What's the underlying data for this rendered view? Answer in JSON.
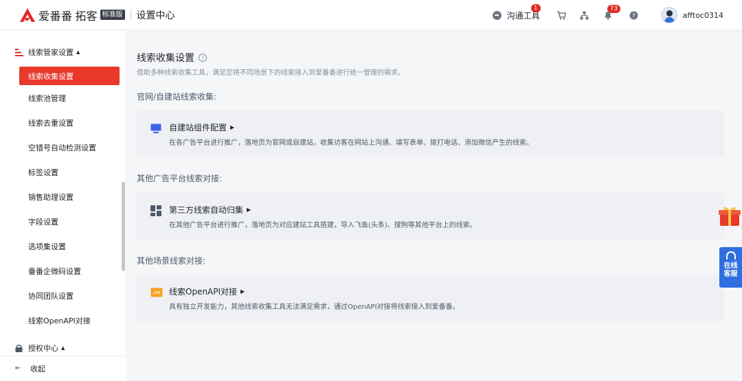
{
  "header": {
    "brand": "爱番番",
    "sub": "拓客",
    "edition_badge": "标准版",
    "title": "设置中心",
    "tool_label": "沟通工具",
    "tool_badge": "1",
    "notification_badge": "73",
    "username": "afftoc0314",
    "icons": [
      "chat-icon",
      "cart-icon",
      "org-icon",
      "bell-icon",
      "help-icon"
    ]
  },
  "sidebar": {
    "group1": "线索管家设置",
    "items": [
      {
        "label": "线索收集设置",
        "active": true
      },
      {
        "label": "线索池管理"
      },
      {
        "label": "线索去重设置"
      },
      {
        "label": "空错号自动检测设置"
      },
      {
        "label": "标签设置"
      },
      {
        "label": "销售助理设置"
      },
      {
        "label": "字段设置"
      },
      {
        "label": "选项集设置"
      },
      {
        "label": "番番企微码设置"
      },
      {
        "label": "协同团队设置"
      },
      {
        "label": "线索OpenAPI对接"
      }
    ],
    "group2": "授权中心",
    "collapse": "收起"
  },
  "main": {
    "title": "线索收集设置",
    "desc": "借助多种线索收集工具，满足您将不同场景下的线索接入到爱番番进行统一管理的需求。",
    "sections": [
      {
        "label": "官网/自建站线索收集:",
        "card_title": "自建站组件配置",
        "card_desc": "在各广告平台进行推广，落地页为官网或自建站，收集访客在网站上沟通、填写表单、拨打电话、添加微信产生的线索。",
        "icon": "monitor-icon"
      },
      {
        "label": "其他广告平台线索对接:",
        "card_title": "第三方线索自动归集",
        "card_desc": "在其他广告平台进行推广，落地页为对应建站工具搭建，导入飞鱼(头条)、搜狗等其他平台上的线索。",
        "icon": "blocks-icon"
      },
      {
        "label": "其他场景线索对接:",
        "card_title": "线索OpenAPI对接",
        "card_desc": "具有独立开发能力，其他线索收集工具无法满足需求，通过OpenAPI对接将线索接入到爱番番。",
        "icon": "api-icon"
      }
    ]
  },
  "floating": {
    "cs_line1": "在线",
    "cs_line2": "客服"
  },
  "colors": {
    "accent": "#e8392b",
    "cs_blue": "#2f6ee0"
  }
}
